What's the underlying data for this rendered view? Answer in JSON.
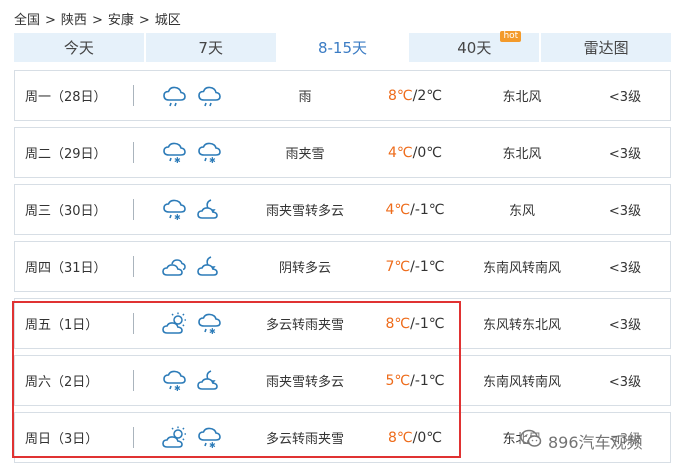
{
  "breadcrumb": [
    "全国",
    "陕西",
    "安康",
    "城区"
  ],
  "breadcrumb_sep": ">",
  "tabs": [
    {
      "label": "今天"
    },
    {
      "label": "7天"
    },
    {
      "label": "8-15天"
    },
    {
      "label": "40天",
      "badge": "hot"
    },
    {
      "label": "雷达图"
    }
  ],
  "active_tab": "8-15天",
  "colors": {
    "accent": "#3b7cc4",
    "high_temp": "#ee6b1a",
    "highlight_border": "#e03232",
    "icon_blue": "#2c7bb8"
  },
  "forecast": [
    {
      "day": "周一（28日）",
      "icons": [
        "rain-cloud-icon",
        "rain-cloud-icon"
      ],
      "desc": "雨",
      "high": "8℃",
      "low": "2℃",
      "wind": "东北风",
      "level": "<3级"
    },
    {
      "day": "周二（29日）",
      "icons": [
        "sleet-cloud-icon",
        "sleet-cloud-icon"
      ],
      "desc": "雨夹雪",
      "high": "4℃",
      "low": "0℃",
      "wind": "东北风",
      "level": "<3级"
    },
    {
      "day": "周三（30日）",
      "icons": [
        "sleet-cloud-icon",
        "moon-cloud-icon"
      ],
      "desc": "雨夹雪转多云",
      "high": "4℃",
      "low": "-1℃",
      "wind": "东风",
      "level": "<3级"
    },
    {
      "day": "周四（31日）",
      "icons": [
        "overcast-cloud-icon",
        "moon-cloud-icon"
      ],
      "desc": "阴转多云",
      "high": "7℃",
      "low": "-1℃",
      "wind": "东南风转南风",
      "level": "<3级"
    },
    {
      "day": "周五（1日）",
      "icons": [
        "sun-cloud-icon",
        "sleet-cloud-icon"
      ],
      "desc": "多云转雨夹雪",
      "high": "8℃",
      "low": "-1℃",
      "wind": "东风转东北风",
      "level": "<3级"
    },
    {
      "day": "周六（2日）",
      "icons": [
        "sleet-cloud-icon",
        "moon-cloud-icon"
      ],
      "desc": "雨夹雪转多云",
      "high": "5℃",
      "low": "-1℃",
      "wind": "东南风转南风",
      "level": "<3级"
    },
    {
      "day": "周日（3日）",
      "icons": [
        "sun-cloud-icon",
        "sleet-cloud-icon"
      ],
      "desc": "多云转雨夹雪",
      "high": "8℃",
      "low": "0℃",
      "wind": "东北风",
      "level": "<3级"
    }
  ],
  "temp_separator": "/",
  "watermark": {
    "text": "896汽车观频",
    "icon": "wechat-icon"
  }
}
